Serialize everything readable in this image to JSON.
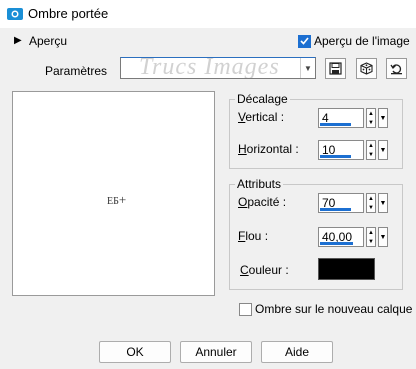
{
  "window": {
    "title": "Ombre portée"
  },
  "preview_toggle": {
    "label": "Aperçu"
  },
  "preview_on_image": {
    "label": "Aperçu de l'image",
    "checked": true
  },
  "presets": {
    "label": "Paramètres",
    "watermark": "Trucs Images"
  },
  "offset": {
    "title": "Décalage",
    "vertical": {
      "label": "Vertical :",
      "value": "4",
      "level": 0.7
    },
    "horizontal": {
      "label": "Horizontal :",
      "value": "10",
      "level": 0.7
    }
  },
  "attributes": {
    "title": "Attributs",
    "opacity": {
      "label": "Opacité :",
      "value": "70",
      "level": 0.7
    },
    "blur": {
      "label": "Flou :",
      "value": "40,00",
      "level": 0.75
    },
    "color": {
      "label": "Couleur :",
      "value": "#000000"
    }
  },
  "new_layer": {
    "label": "Ombre sur le nouveau calque",
    "checked": false
  },
  "buttons": {
    "ok": "OK",
    "cancel": "Annuler",
    "help": "Aide"
  },
  "colors": {
    "accent": "#1c6fd1",
    "shadow": "#000000"
  }
}
